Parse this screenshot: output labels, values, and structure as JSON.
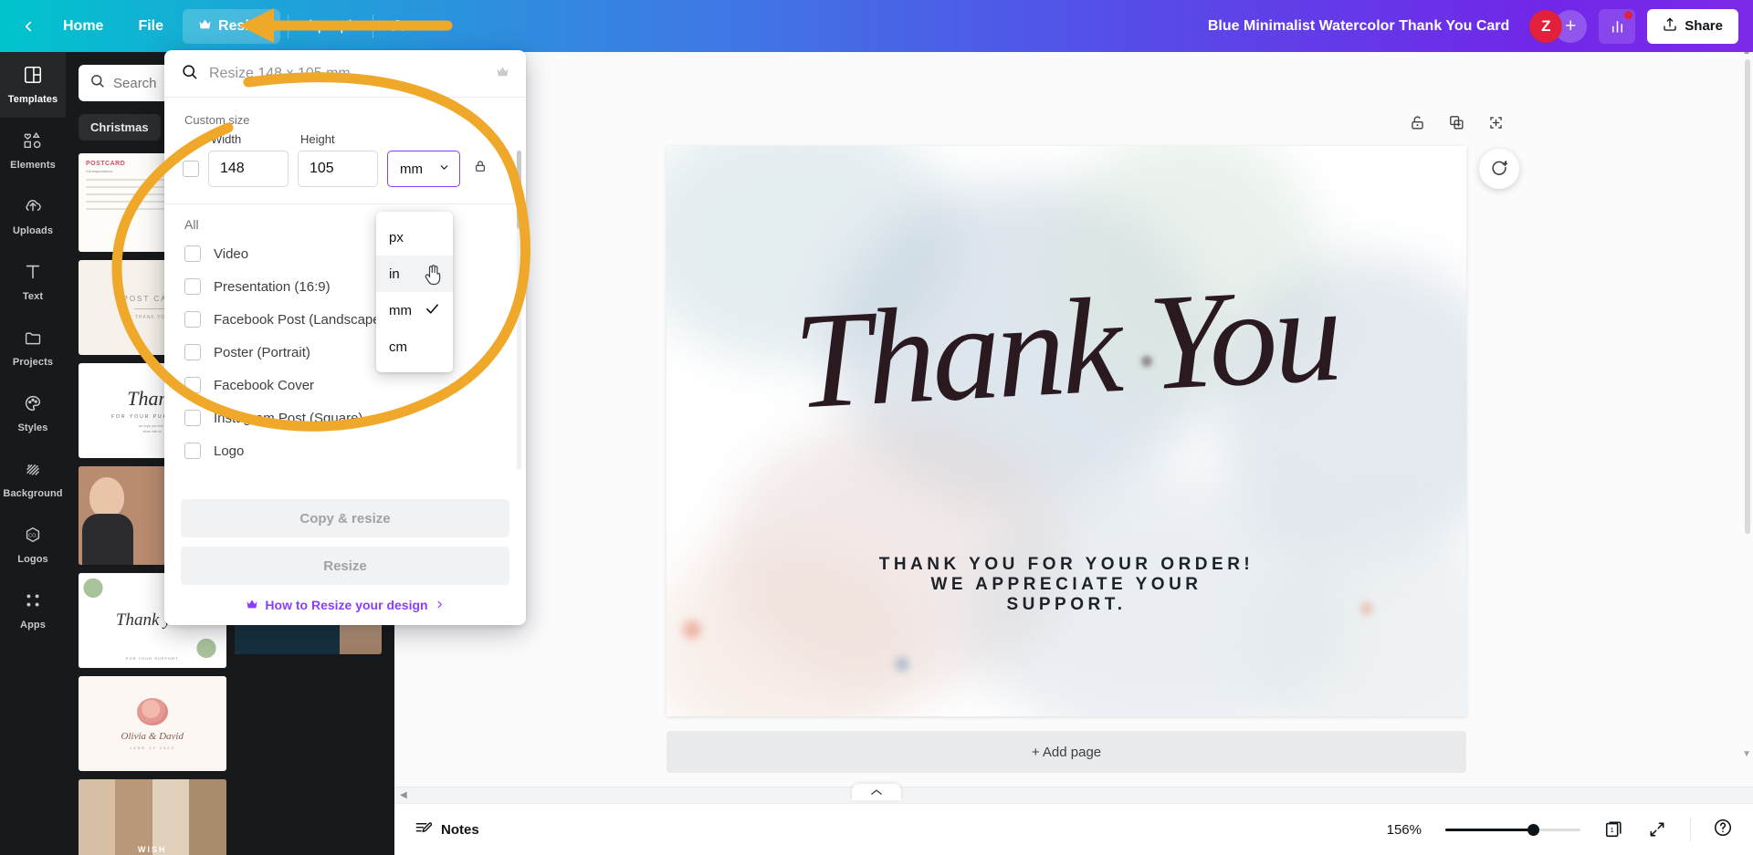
{
  "topbar": {
    "back_icon": "chevron-left-icon",
    "items": [
      {
        "label": "Home",
        "icon": null,
        "active": false
      },
      {
        "label": "File",
        "icon": null,
        "active": false
      },
      {
        "label": "Resize",
        "icon": "crown-icon",
        "active": true
      }
    ],
    "undo_icon": "undo-icon",
    "redo_icon": "redo-icon",
    "cloud_icon": "cloud-sync-icon",
    "doc_title": "Blue Minimalist Watercolor Thank You Card",
    "avatar_initial": "Z",
    "avatar_color": "#e1213b",
    "add_collaborator_label": "+",
    "stats_icon": "bar-chart-icon",
    "stats_badge": true,
    "share_label": "Share",
    "share_icon": "upload-icon"
  },
  "rail": {
    "items": [
      {
        "label": "Templates",
        "icon": "templates-icon",
        "active": true
      },
      {
        "label": "Elements",
        "icon": "elements-icon",
        "active": false
      },
      {
        "label": "Uploads",
        "icon": "upload-cloud-icon",
        "active": false
      },
      {
        "label": "Text",
        "icon": "text-icon",
        "active": false
      },
      {
        "label": "Projects",
        "icon": "folder-icon",
        "active": false
      },
      {
        "label": "Styles",
        "icon": "palette-icon",
        "active": false
      },
      {
        "label": "Background",
        "icon": "background-icon",
        "active": false
      },
      {
        "label": "Logos",
        "icon": "logo-hexagon-icon",
        "active": false
      },
      {
        "label": "Apps",
        "icon": "apps-grid-icon",
        "active": false
      }
    ]
  },
  "templates_panel": {
    "search_placeholder": "Search",
    "search_value": "",
    "search_icon": "search-icon",
    "chips": [
      "Christmas"
    ]
  },
  "resize_popover": {
    "search_placeholder": "Resize 148 x 105 mm",
    "search_icon": "search-icon",
    "crown_icon": "crown-icon",
    "custom_size_label": "Custom size",
    "width_label": "Width",
    "height_label": "Height",
    "width_value": "148",
    "height_value": "105",
    "unit_value": "mm",
    "unit_chevron_icon": "chevron-down-icon",
    "lock_icon": "lock-ratio-icon",
    "all_label": "All",
    "size_options": [
      {
        "label": "Video",
        "checked": false
      },
      {
        "label": "Presentation (16:9)",
        "checked": false
      },
      {
        "label": "Facebook Post (Landscape)",
        "checked": false
      },
      {
        "label": "Poster (Portrait)",
        "checked": false
      },
      {
        "label": "Facebook Cover",
        "checked": false
      },
      {
        "label": "Instagram Post (Square)",
        "checked": false
      },
      {
        "label": "Logo",
        "checked": false
      }
    ],
    "copy_resize_label": "Copy & resize",
    "resize_label": "Resize",
    "help_label": "How to Resize your design",
    "help_crown_icon": "crown-icon",
    "help_chevron_icon": "chevron-right-icon",
    "accent_color": "#8b3dff"
  },
  "unit_dropdown": {
    "options": [
      {
        "label": "px",
        "selected": false,
        "hovered": false
      },
      {
        "label": "in",
        "selected": false,
        "hovered": true
      },
      {
        "label": "mm",
        "selected": true,
        "hovered": false
      },
      {
        "label": "cm",
        "selected": false,
        "hovered": false
      }
    ],
    "check_icon": "check-icon",
    "cursor_icon": "pointer-hand-cursor"
  },
  "canvas": {
    "page_tools": [
      {
        "icon": "unlock-icon",
        "name": "lock-page"
      },
      {
        "icon": "duplicate-page-icon",
        "name": "duplicate-page"
      },
      {
        "icon": "add-page-icon",
        "name": "add-page"
      }
    ],
    "magic_icon": "magic-switch-icon",
    "design": {
      "headline": "Thank You",
      "line1": "THANK YOU FOR YOUR ORDER!",
      "line2": "WE APPRECIATE YOUR",
      "line3": "SUPPORT."
    },
    "add_page_label": "+ Add page"
  },
  "bottombar": {
    "notes_label": "Notes",
    "notes_icon": "notes-pencil-icon",
    "zoom_value": "156%",
    "zoom_percent": 62,
    "page_count_label": "1",
    "page_manager_icon": "page-manager-icon",
    "fullscreen_icon": "expand-icon",
    "help_icon": "question-circle-icon",
    "collapse_icon": "chevron-up-icon"
  },
  "annotation": {
    "color": "#f0a82a",
    "arrow_name": "orange-arrow-annotation",
    "circle_name": "orange-circle-annotation"
  }
}
